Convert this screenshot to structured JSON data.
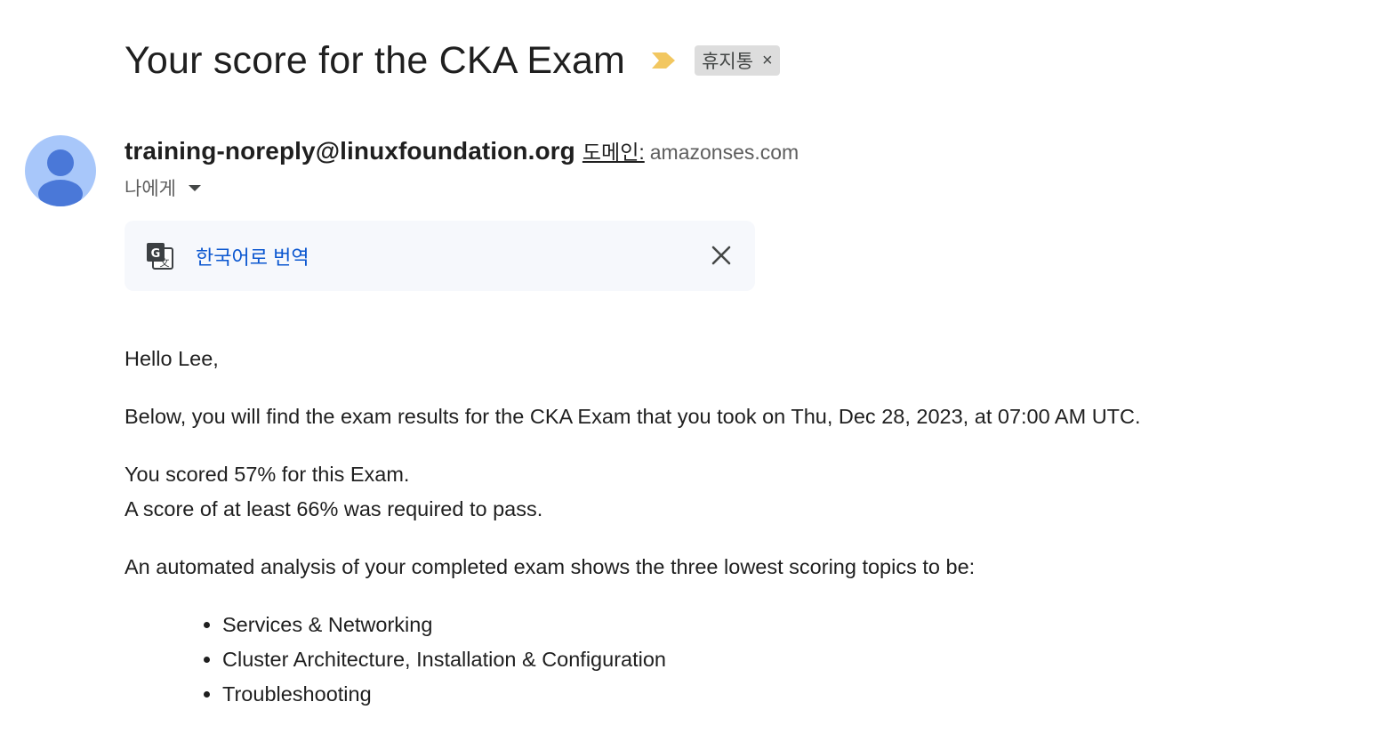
{
  "subject": {
    "title": "Your score for the CKA Exam",
    "importance_icon": "importance-marker-icon",
    "label_chip": {
      "text": "휴지통",
      "close_glyph": "×"
    }
  },
  "sender": {
    "avatar_icon": "person-avatar-icon",
    "email": "training-noreply@linuxfoundation.org",
    "domain_label": "도메인:",
    "domain": "amazonses.com",
    "recipient_text": "나에게",
    "recipient_icon": "caret-down-icon"
  },
  "translate_bar": {
    "icon": "google-translate-icon",
    "link_text": "한국어로 번역",
    "close_icon": "close-icon"
  },
  "body": {
    "greeting": "Hello Lee,",
    "intro": "Below, you will find the exam results for the CKA Exam that you took on Thu, Dec 28, 2023, at 07:00 AM UTC.",
    "score_line": "You scored 57% for this Exam.",
    "required_line": "A score of at least 66% was required to pass.",
    "analysis_intro": "An automated analysis of your completed exam shows the three lowest scoring topics to be:",
    "topics": [
      "Services & Networking",
      "Cluster Architecture, Installation & Configuration",
      "Troubleshooting"
    ]
  },
  "colors": {
    "link_blue": "#0b57d0",
    "importance_yellow": "#f2c760",
    "avatar_bg": "#a8c7fa",
    "avatar_fg": "#4a78d8",
    "chip_bg": "#dddddd",
    "translate_bar_bg": "#f6f8fc"
  }
}
